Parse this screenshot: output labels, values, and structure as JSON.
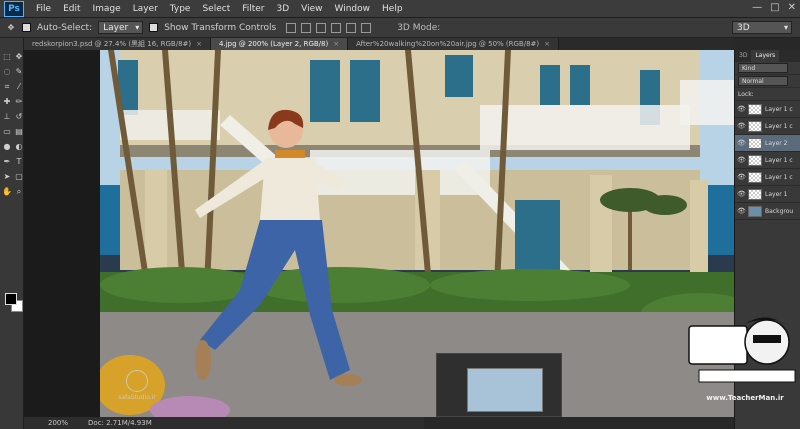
{
  "app": {
    "logo": "Ps"
  },
  "menu": [
    "File",
    "Edit",
    "Image",
    "Layer",
    "Type",
    "Select",
    "Filter",
    "3D",
    "View",
    "Window",
    "Help"
  ],
  "window_controls": {
    "minimize": "—",
    "maximize": "□",
    "close": "✕"
  },
  "options": {
    "auto_select_label": "Auto-Select:",
    "auto_select_value": "Layer",
    "show_transform_label": "Show Transform Controls",
    "mode_3d_label": "3D Mode:",
    "workspace": "3D"
  },
  "tabs": [
    {
      "label": "redskorpion3.psd @ 27.4% (黑組 16, RGB/8#)",
      "active": false
    },
    {
      "label": "4.jpg @ 200% (Layer 2, RGB/8)",
      "active": true
    },
    {
      "label": "After%20walking%20on%20air.jpg @ 50% (RGB/8#)",
      "active": false
    }
  ],
  "status": {
    "zoom": "200%",
    "doc": "Doc: 2.71M/4.93M"
  },
  "panel": {
    "tabs": [
      "3D",
      "Layers"
    ],
    "kind": "Kind",
    "blend": "Normal",
    "lock_label": "Lock:",
    "layers": [
      {
        "name": "Layer 1 c",
        "active": false,
        "bg": false
      },
      {
        "name": "Layer 1 c",
        "active": false,
        "bg": false
      },
      {
        "name": "Layer 2",
        "active": true,
        "bg": false
      },
      {
        "name": "Layer 1 c",
        "active": false,
        "bg": false
      },
      {
        "name": "Layer 1 c",
        "active": false,
        "bg": false
      },
      {
        "name": "Layer 1",
        "active": false,
        "bg": false
      },
      {
        "name": "Backgrou",
        "active": false,
        "bg": true
      }
    ]
  },
  "watermark_left": {
    "site": "safaStudio.ir"
  },
  "watermark_right": {
    "brand": "TeacherMan",
    "url": "www.TeacherMan.ir"
  }
}
